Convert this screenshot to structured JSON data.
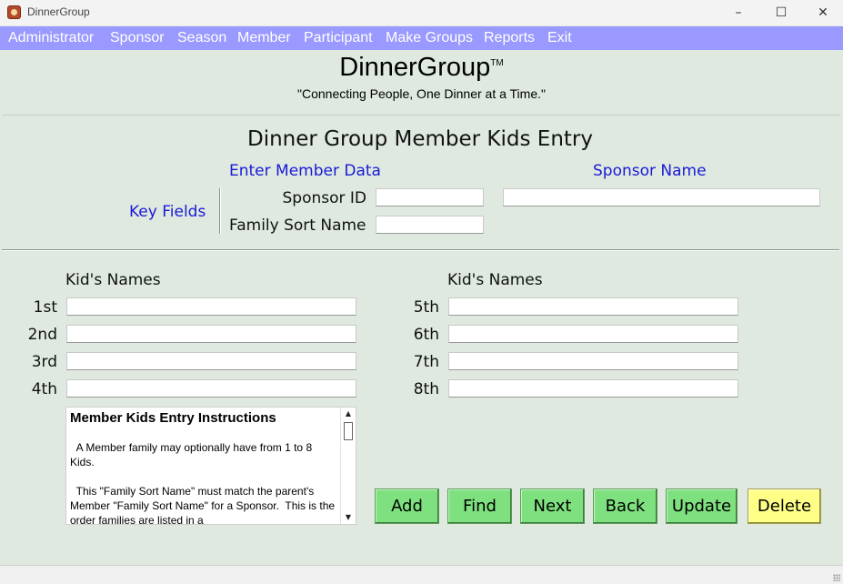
{
  "window": {
    "title": "DinnerGroup",
    "minimize_glyph": "–",
    "maximize_glyph": "☐",
    "close_glyph": "✕"
  },
  "menu": {
    "items": [
      "Administrator",
      "Sponsor",
      "Season",
      "Member",
      "Participant",
      "Make Groups",
      "Reports",
      "Exit"
    ]
  },
  "brand": {
    "title": "DinnerGroup",
    "trademark": "TM",
    "tagline": "\"Connecting People, One Dinner at a Time.\""
  },
  "form": {
    "title": "Dinner Group Member Kids Entry",
    "enter_member_data": "Enter Member Data",
    "sponsor_name_label": "Sponsor Name",
    "key_fields": "Key Fields",
    "sponsor_id_label": "Sponsor ID",
    "family_sort_name_label": "Family Sort Name",
    "sponsor_id_value": "",
    "family_sort_name_value": "",
    "sponsor_name_value": ""
  },
  "kids": {
    "header_left": "Kid's Names",
    "header_right": "Kid's Names",
    "ordinals": [
      "1st",
      "2nd",
      "3rd",
      "4th",
      "5th",
      "6th",
      "7th",
      "8th"
    ],
    "values": [
      "",
      "",
      "",
      "",
      "",
      "",
      "",
      ""
    ]
  },
  "instructions": {
    "heading": "Member Kids Entry Instructions",
    "paragraphs": [
      "  A Member family may optionally have from 1 to 8 Kids.",
      "  This \"Family Sort Name\" must match the parent's Member \"Family Sort Name\" for a Sponsor.  This is the order families are listed in a"
    ],
    "scroll_up_glyph": "▲",
    "scroll_down_glyph": "▼"
  },
  "buttons": {
    "add": "Add",
    "find": "Find",
    "next": "Next",
    "back": "Back",
    "update": "Update",
    "delete": "Delete"
  },
  "colors": {
    "background": "#dfe9df",
    "menubar": "#9999ff",
    "button_green": "#7ee07e",
    "button_yellow": "#ffff88",
    "label_blue": "#1a1ad6"
  }
}
